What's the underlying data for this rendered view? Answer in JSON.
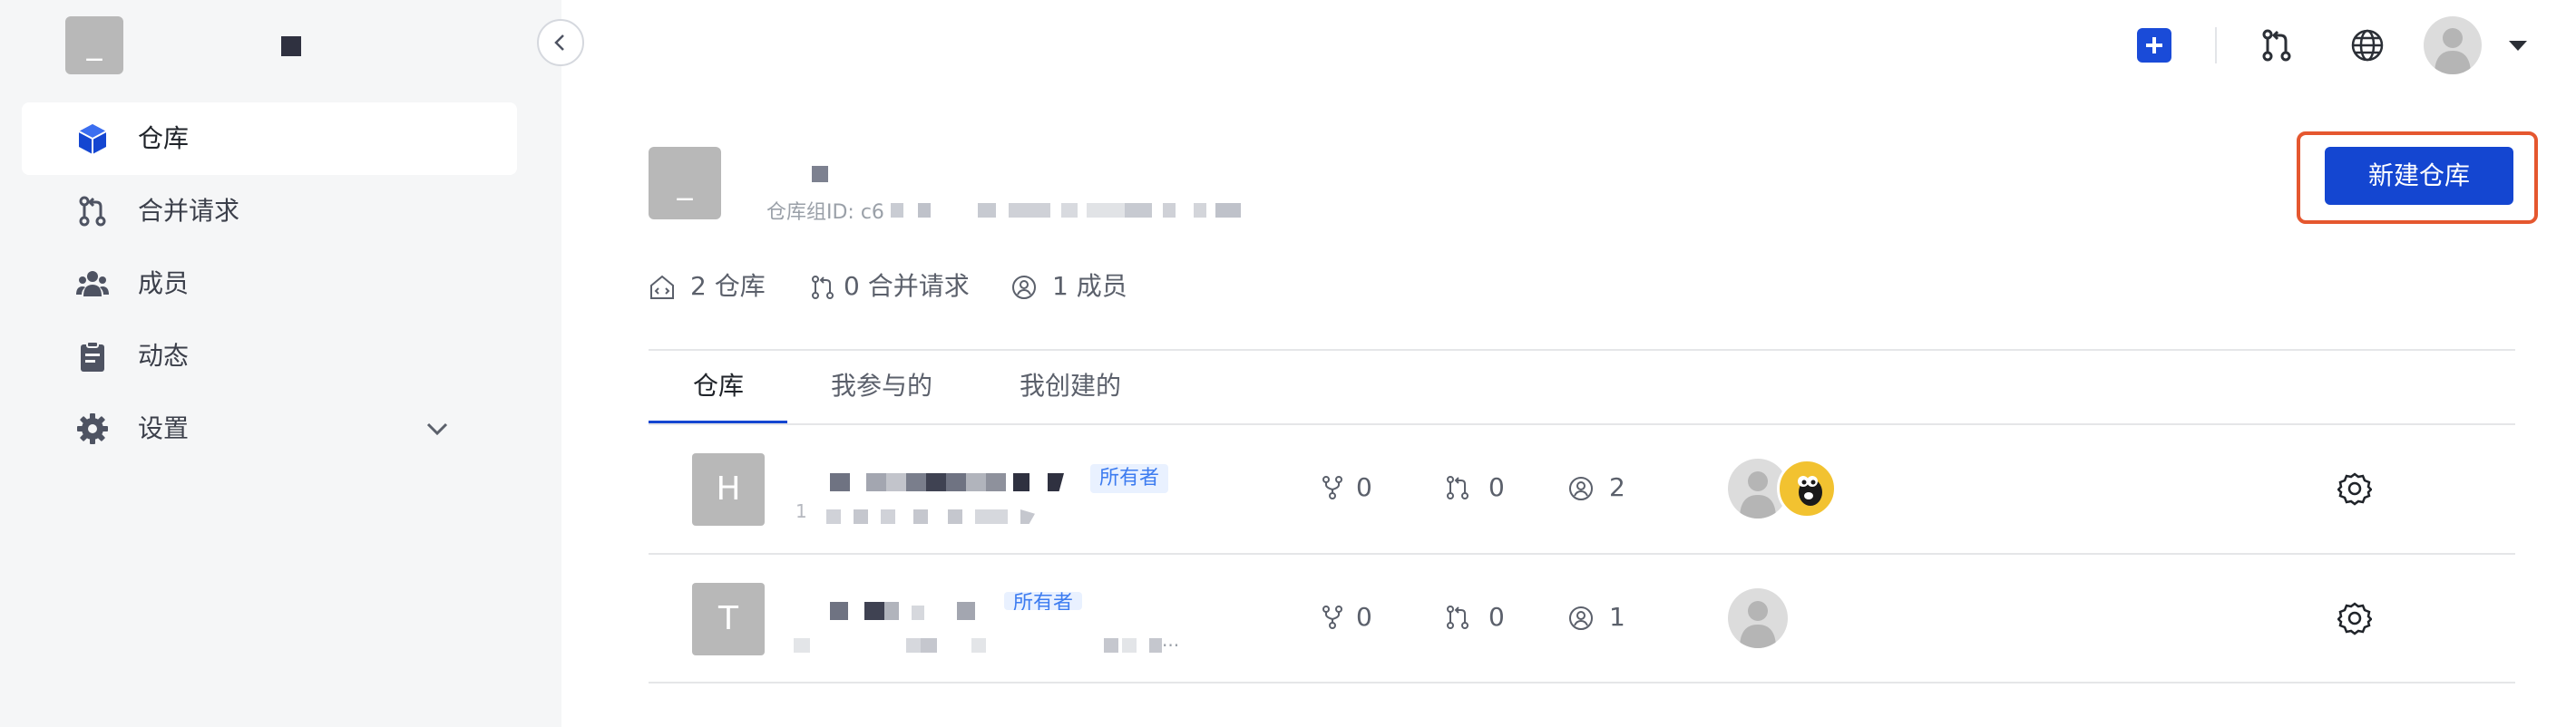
{
  "sidebar": {
    "logo_letter": "_",
    "items": [
      {
        "label": "仓库",
        "icon": "cube-icon"
      },
      {
        "label": "合并请求",
        "icon": "merge-request-icon"
      },
      {
        "label": "成员",
        "icon": "members-icon"
      },
      {
        "label": "动态",
        "icon": "clipboard-icon"
      },
      {
        "label": "设置",
        "icon": "gear-icon"
      }
    ]
  },
  "topbar": {
    "icons": [
      "plus-icon",
      "merge-request-icon",
      "globe-icon",
      "avatar",
      "caret-down-icon"
    ]
  },
  "group": {
    "avatar_letter": "_",
    "id_label": "仓库组ID: c6",
    "new_repo_button": "新建仓库"
  },
  "stats": [
    {
      "value": "2 仓库",
      "icon": "repo-code-icon"
    },
    {
      "value": "0 合并请求",
      "icon": "merge-request-icon"
    },
    {
      "value": "1 成员",
      "icon": "user-circle-icon"
    }
  ],
  "tabs": [
    {
      "label": "仓库",
      "active": true
    },
    {
      "label": "我参与的",
      "active": false
    },
    {
      "label": "我创建的",
      "active": false
    }
  ],
  "repos": [
    {
      "letter": "H",
      "badge": "所有者",
      "desc_prefix": "1",
      "forks": "0",
      "merge_requests": "0",
      "members": "2",
      "avatars": 2
    },
    {
      "letter": "T",
      "badge": "所有者",
      "desc_suffix": "...",
      "forks": "0",
      "merge_requests": "0",
      "members": "1",
      "avatars": 1
    }
  ],
  "colors": {
    "accent": "#1446d1",
    "highlight": "#e5572f",
    "badge_text": "#3d7cf0",
    "badge_bg": "#e9f1ff"
  }
}
